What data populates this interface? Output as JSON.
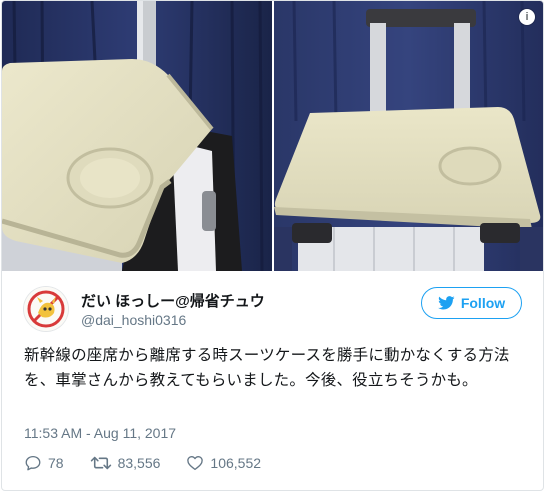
{
  "tweet": {
    "author_name": "だい ほっしー@帰省チュウ",
    "author_handle": "@dai_hoshi0316",
    "follow_label": "Follow",
    "text": "新幹線の座席から離席する時スーツケースを勝手に動かなくする方法を、車掌さんから教えてもらいました。今後、役立ちそうかも。",
    "timestamp": "11:53 AM - Aug 11, 2017",
    "replies": "78",
    "retweets": "83,556",
    "likes": "106,552"
  },
  "icons": {
    "info": "info-icon",
    "reply": "reply-icon",
    "retweet": "retweet-icon",
    "like": "heart-icon",
    "follow": "twitter-bird-icon"
  },
  "colors": {
    "accent": "#1da1f2",
    "text": "#14171a",
    "muted": "#657786"
  }
}
